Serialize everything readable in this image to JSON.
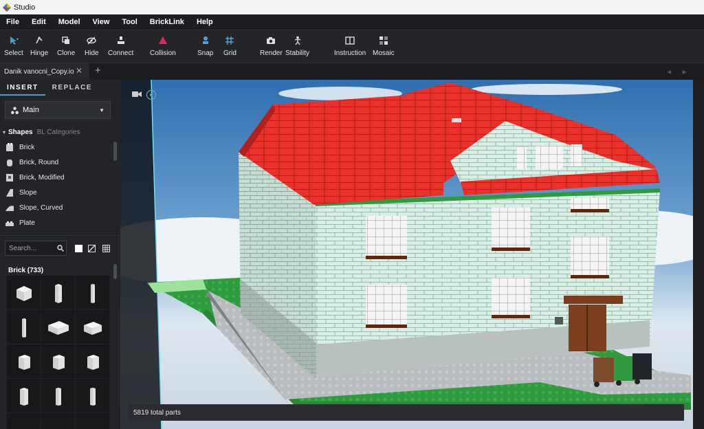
{
  "app": {
    "title": "Studio"
  },
  "menu": [
    "File",
    "Edit",
    "Model",
    "View",
    "Tool",
    "BrickLink",
    "Help"
  ],
  "toolbar": {
    "select": "Select",
    "hinge": "Hinge",
    "clone": "Clone",
    "hide": "Hide",
    "connect": "Connect",
    "collision": "Collision",
    "snap": "Snap",
    "grid": "Grid",
    "render": "Render",
    "stability": "Stability",
    "instruction": "Instruction",
    "mosaic": "Mosaic"
  },
  "tabs": {
    "document": "Danik vanocni_Copy.io",
    "close": "✕",
    "add": "+"
  },
  "sidebar": {
    "insert": "INSERT",
    "replace": "REPLACE",
    "palette": "Main",
    "shapes": "Shapes",
    "bl_categories": "BL Categories",
    "categories": [
      "Brick",
      "Brick, Round",
      "Brick, Modified",
      "Slope",
      "Slope, Curved",
      "Plate"
    ],
    "search_placeholder": "Search...",
    "brick_header": "Brick (733)"
  },
  "status": {
    "parts": "5819 total parts"
  },
  "colors": {
    "accent": "#3aa0d8",
    "roof": "#e8322b",
    "wall": "#d6efe6",
    "baseplate": "#2f9a3e"
  }
}
